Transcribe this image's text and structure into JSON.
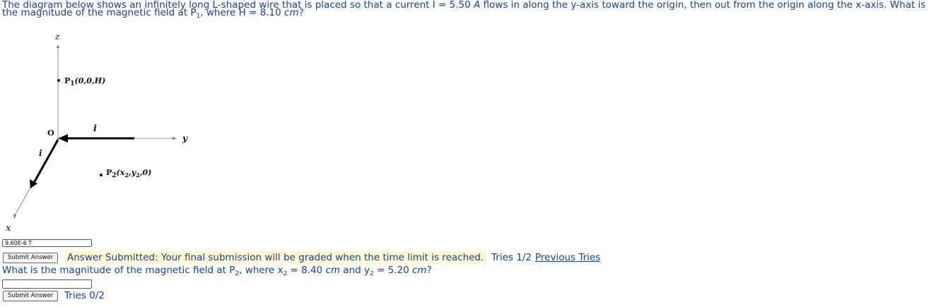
{
  "question1": {
    "p1": "The diagram below shows an infinitely long L-shaped wire that is placed so that a current I = 5.50 ",
    "unit_current": "A",
    "p2": " flows in along the y-axis toward the origin, then out from the origin along the x-axis. What is the magnitude of the magnetic field at P",
    "sub1": "1",
    "p3": ", where H = 8.10 ",
    "unit_cm": "cm",
    "p4": "?"
  },
  "diagram": {
    "z_label": "z",
    "y_label": "y",
    "x_label": "x",
    "origin_label": "O",
    "i_top": "i",
    "i_side": "i",
    "p1_label": "P",
    "p1_sub": "1",
    "p1_coords": "(0,0,H)",
    "p2_label": "P",
    "p2_sub": "2",
    "p2_coords": "(x",
    "p2_x_sub": "2",
    "p2_mid": ",y",
    "p2_y_sub": "2",
    "p2_end": ",0)"
  },
  "answer1": {
    "value": "9.60E-6 T"
  },
  "submit1": {
    "label": "Submit Answer"
  },
  "status1": {
    "text": "Answer Submitted: Your final submission will be graded when the time limit is reached."
  },
  "tries1": {
    "text": "Tries 1/2"
  },
  "previous_tries": {
    "label": "Previous Tries"
  },
  "question2": {
    "p1": "What is the magnitude of the magnetic field at P",
    "sub_p": "2",
    "p2": ", where x",
    "sub_x": "2",
    "p3": " = 8.40 ",
    "unit1": "cm",
    "p4": " and y",
    "sub_y": "2",
    "p5": " = 5.20 ",
    "unit2": "cm",
    "p6": "?"
  },
  "answer2": {
    "value": ""
  },
  "submit2": {
    "label": "Submit Answer"
  },
  "tries2": {
    "text": "Tries 0/2"
  }
}
